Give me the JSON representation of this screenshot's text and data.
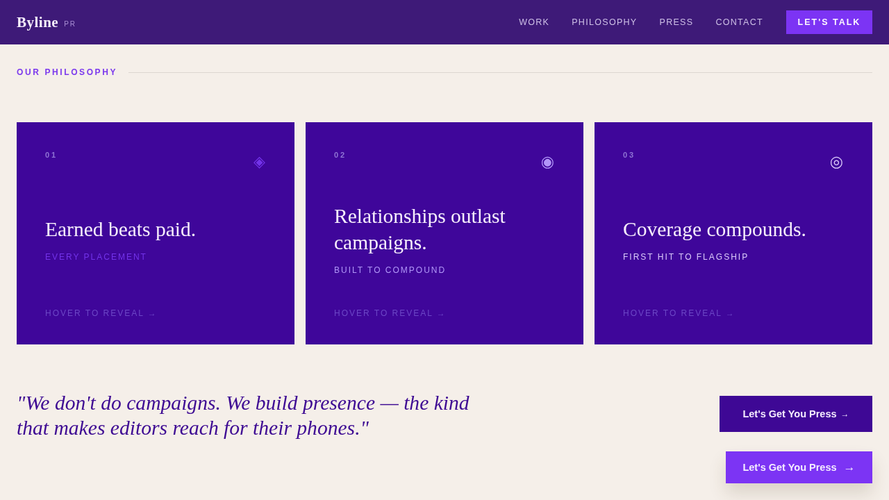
{
  "header": {
    "logo": "Byline",
    "logo_suffix": "PR",
    "nav": [
      "WORK",
      "PHILOSOPHY",
      "PRESS",
      "CONTACT"
    ],
    "cta": "LET'S TALK"
  },
  "section": {
    "label": "OUR PHILOSOPHY"
  },
  "cards": [
    {
      "number": "01",
      "icon": "◈",
      "title": "Earned beats paid.",
      "tagline": "EVERY PLACEMENT",
      "hint": "HOVER TO REVEAL →",
      "color": "#7333ea"
    },
    {
      "number": "02",
      "icon": "◉",
      "title": "Relationships outlast campaigns.",
      "tagline": "BUILT TO COMPOUND",
      "hint": "HOVER TO REVEAL →",
      "color": "#b196f8"
    },
    {
      "number": "03",
      "icon": "◎",
      "title": "Coverage compounds.",
      "tagline": "FIRST HIT TO FLAGSHIP",
      "hint": "HOVER TO REVEAL →",
      "color": "#dccbfb"
    }
  ],
  "quote": "\"We don't do campaigns. We build presence — the kind that makes editors reach for their phones.\"",
  "buttons": [
    {
      "kind": "dark",
      "label": "Let's Get You Press",
      "arrow": "→"
    },
    {
      "kind": "bright",
      "label": "Let's Get You Press",
      "arrow": "→"
    }
  ]
}
